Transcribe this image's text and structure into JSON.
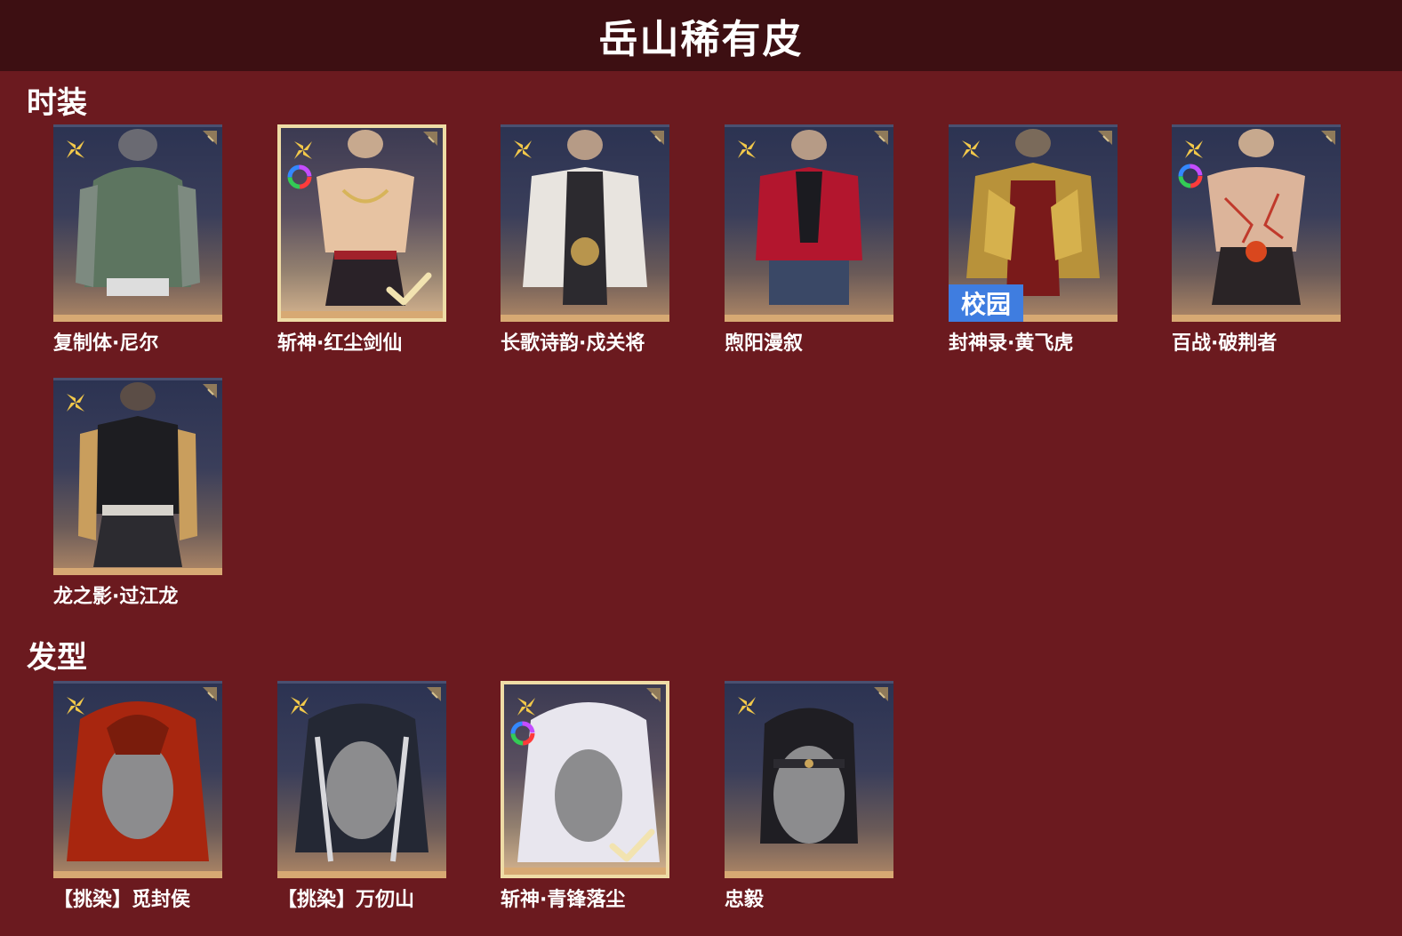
{
  "header": {
    "title": "岳山稀有皮"
  },
  "sections": [
    {
      "title": "时装",
      "items": [
        {
          "name": "复制体·尼尔",
          "selected": false,
          "dye": false,
          "badge": ""
        },
        {
          "name": "斩神·红尘剑仙",
          "selected": true,
          "dye": true,
          "badge": ""
        },
        {
          "name": "长歌诗韵·戍关将",
          "selected": false,
          "dye": false,
          "badge": ""
        },
        {
          "name": "煦阳漫叙",
          "selected": false,
          "dye": false,
          "badge": ""
        },
        {
          "name": "封神录·黄飞虎",
          "selected": false,
          "dye": false,
          "badge": "校园"
        },
        {
          "name": "百战·破荆者",
          "selected": false,
          "dye": true,
          "badge": ""
        },
        {
          "name": "龙之影·过江龙",
          "selected": false,
          "dye": false,
          "badge": ""
        }
      ]
    },
    {
      "title": "发型",
      "items": [
        {
          "name": "【挑染】觅封侯",
          "selected": false,
          "dye": false,
          "badge": ""
        },
        {
          "name": "【挑染】万仞山",
          "selected": false,
          "dye": false,
          "badge": ""
        },
        {
          "name": "斩神·青锋落尘",
          "selected": true,
          "dye": true,
          "badge": ""
        },
        {
          "name": "忠毅",
          "selected": false,
          "dye": false,
          "badge": ""
        }
      ]
    }
  ],
  "colors": {
    "background": "#6b1a1f",
    "header": "#3d0f12",
    "selected_border": "#efdca6",
    "badge": "#3f7de0"
  },
  "icons": {
    "rarity": "flower-icon",
    "dye": "color-ring-icon",
    "owned": "checkmark-icon",
    "corner": "corner-tag-icon"
  }
}
